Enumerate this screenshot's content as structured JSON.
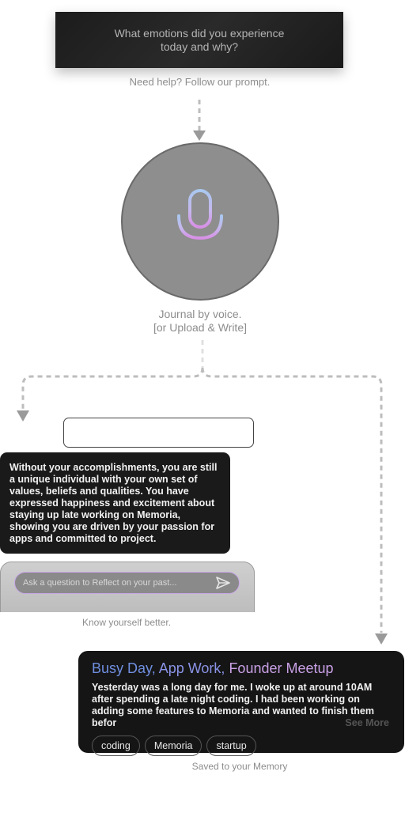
{
  "prompt": {
    "question": "What emotions did you experience today and why?",
    "help": "Need help? Follow our prompt."
  },
  "voice": {
    "icon": "microphone-icon",
    "caption_line1": "Journal by voice.",
    "caption_line2": "[or Upload & Write]"
  },
  "reflect": {
    "response": "Without your accomplishments, you are still a unique individual with your own set of values, beliefs and qualities. You have expressed happiness and excitement about staying up late working on Memoria, showing you are driven by your passion for apps and committed to project.",
    "placeholder": "Ask a question to Reflect on your past...",
    "send_icon": "send-icon",
    "caption": "Know yourself better."
  },
  "memory": {
    "title_parts": [
      {
        "text": "Busy Day,",
        "color": "#6f8fe0"
      },
      {
        "text": "App Work,",
        "color": "#8a93e6"
      },
      {
        "text": "Founder Meetup",
        "color": "#c9a0e6"
      }
    ],
    "excerpt": "Yesterday was a long day for me. I woke up at around 10AM after spending a late night coding. I had been working on adding some features to Memoria and wanted to finish them befor",
    "see_more": "See More",
    "tags": [
      "coding",
      "Memoria",
      "startup"
    ],
    "caption": "Saved to your Memory"
  },
  "colors": {
    "accent_blue": "#7fa0e8",
    "accent_purple": "#d08fe0",
    "dark_card": "#151515"
  }
}
